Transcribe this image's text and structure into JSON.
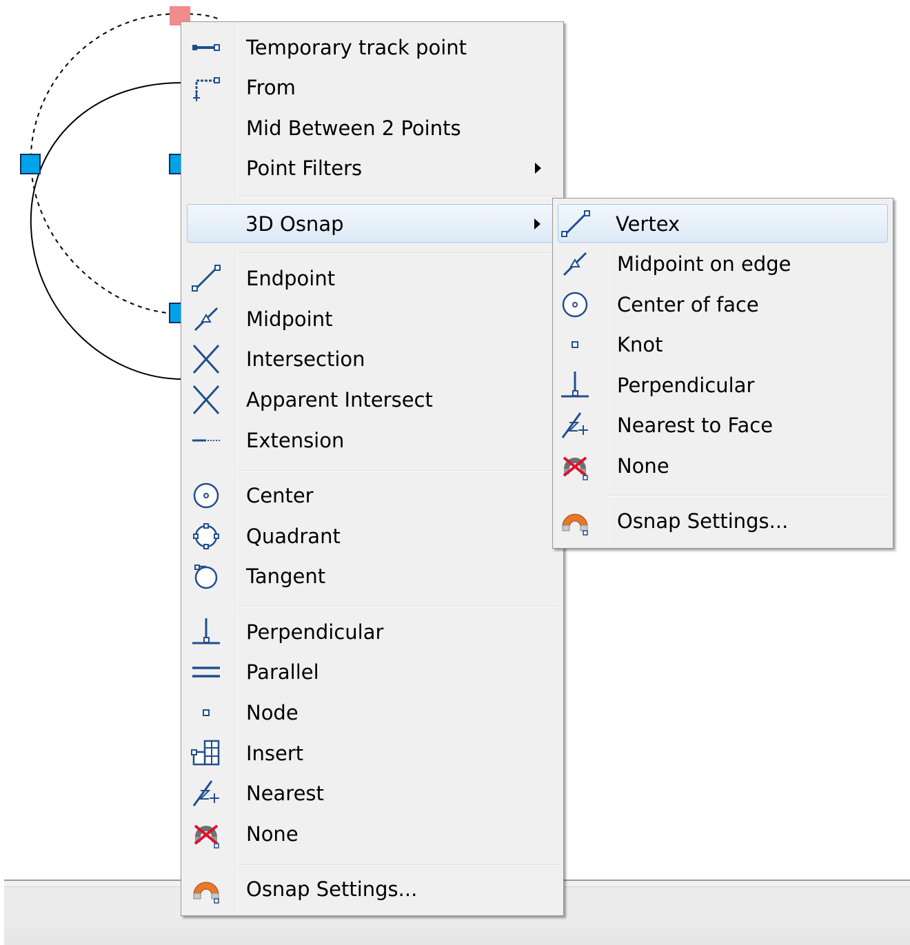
{
  "main_menu": {
    "items": [
      {
        "label": "Temporary track point",
        "icon": "temporary-track-point-icon"
      },
      {
        "label": "From",
        "icon": "from-icon"
      },
      {
        "label": "Mid Between 2 Points",
        "icon": ""
      },
      {
        "label": "Point Filters",
        "icon": "",
        "submenu": true
      },
      {
        "label": "3D Osnap",
        "icon": "",
        "submenu": true,
        "highlighted": true
      },
      {
        "label": "Endpoint",
        "icon": "endpoint-icon"
      },
      {
        "label": "Midpoint",
        "icon": "midpoint-icon"
      },
      {
        "label": "Intersection",
        "icon": "intersection-icon"
      },
      {
        "label": "Apparent Intersect",
        "icon": "apparent-intersect-icon"
      },
      {
        "label": "Extension",
        "icon": "extension-icon"
      },
      {
        "label": "Center",
        "icon": "center-icon"
      },
      {
        "label": "Quadrant",
        "icon": "quadrant-icon"
      },
      {
        "label": "Tangent",
        "icon": "tangent-icon"
      },
      {
        "label": "Perpendicular",
        "icon": "perpendicular-icon"
      },
      {
        "label": "Parallel",
        "icon": "parallel-icon"
      },
      {
        "label": "Node",
        "icon": "node-icon"
      },
      {
        "label": "Insert",
        "icon": "insert-icon"
      },
      {
        "label": "Nearest",
        "icon": "nearest-icon"
      },
      {
        "label": "None",
        "icon": "none-icon"
      },
      {
        "label": "Osnap Settings...",
        "icon": "osnap-settings-icon"
      }
    ]
  },
  "submenu_3d_osnap": {
    "items": [
      {
        "label": "Vertex",
        "icon": "vertex-icon",
        "highlighted": true
      },
      {
        "label": "Midpoint on edge",
        "icon": "midpoint-on-edge-icon"
      },
      {
        "label": "Center of face",
        "icon": "center-of-face-icon"
      },
      {
        "label": "Knot",
        "icon": "knot-icon"
      },
      {
        "label": "Perpendicular",
        "icon": "perpendicular-icon"
      },
      {
        "label": "Nearest to Face",
        "icon": "nearest-to-face-icon"
      },
      {
        "label": "None",
        "icon": "none-icon"
      },
      {
        "label": "Osnap Settings...",
        "icon": "osnap-settings-icon"
      }
    ]
  },
  "colors": {
    "icon_blue": "#1f4e8c",
    "grip_blue": "#00a2e8",
    "grip_hot": "#f08c8c",
    "menu_bg": "#f0f0f0",
    "highlight_border": "#a8c6ea"
  }
}
